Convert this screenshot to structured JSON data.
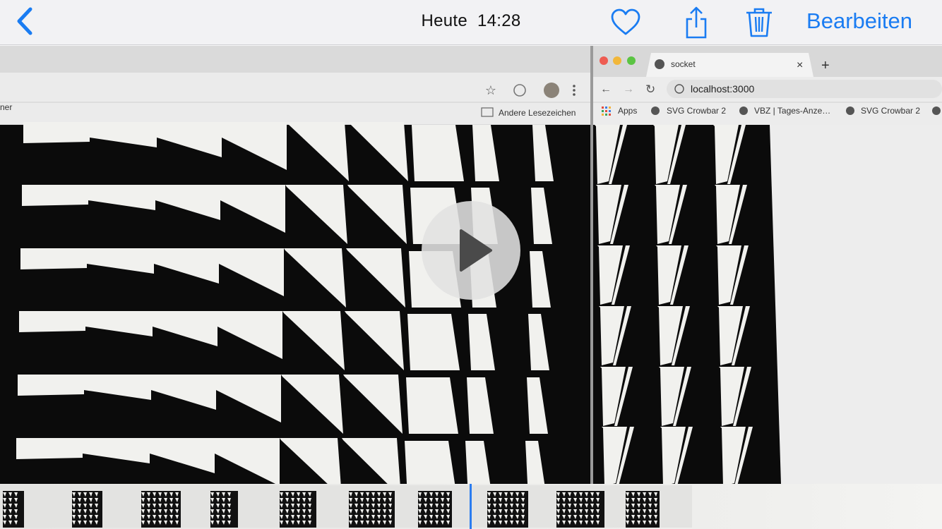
{
  "nav": {
    "back_icon": "chevron-left-icon",
    "title_label": "Heute",
    "title_time": "14:28",
    "favorite_icon": "heart-icon",
    "share_icon": "share-icon",
    "delete_icon": "trash-icon",
    "edit_label": "Bearbeiten",
    "accent_color": "#1a7cf2"
  },
  "photo": {
    "left_window": {
      "bookmark_partial": "ner",
      "other_bookmarks_label": "Andere Lesezeichen"
    },
    "right_window": {
      "tab_title": "socket",
      "tab_close": "×",
      "new_tab": "+",
      "address": "localhost:3000",
      "bookmarks": [
        "Apps",
        "SVG Crowbar 2",
        "VBZ | Tages-Anze…",
        "SVG Crowbar 2"
      ]
    },
    "play_icon": "play-icon"
  },
  "filmstrip": {
    "frame_count": 10,
    "playhead_color": "#2b7cf0"
  }
}
